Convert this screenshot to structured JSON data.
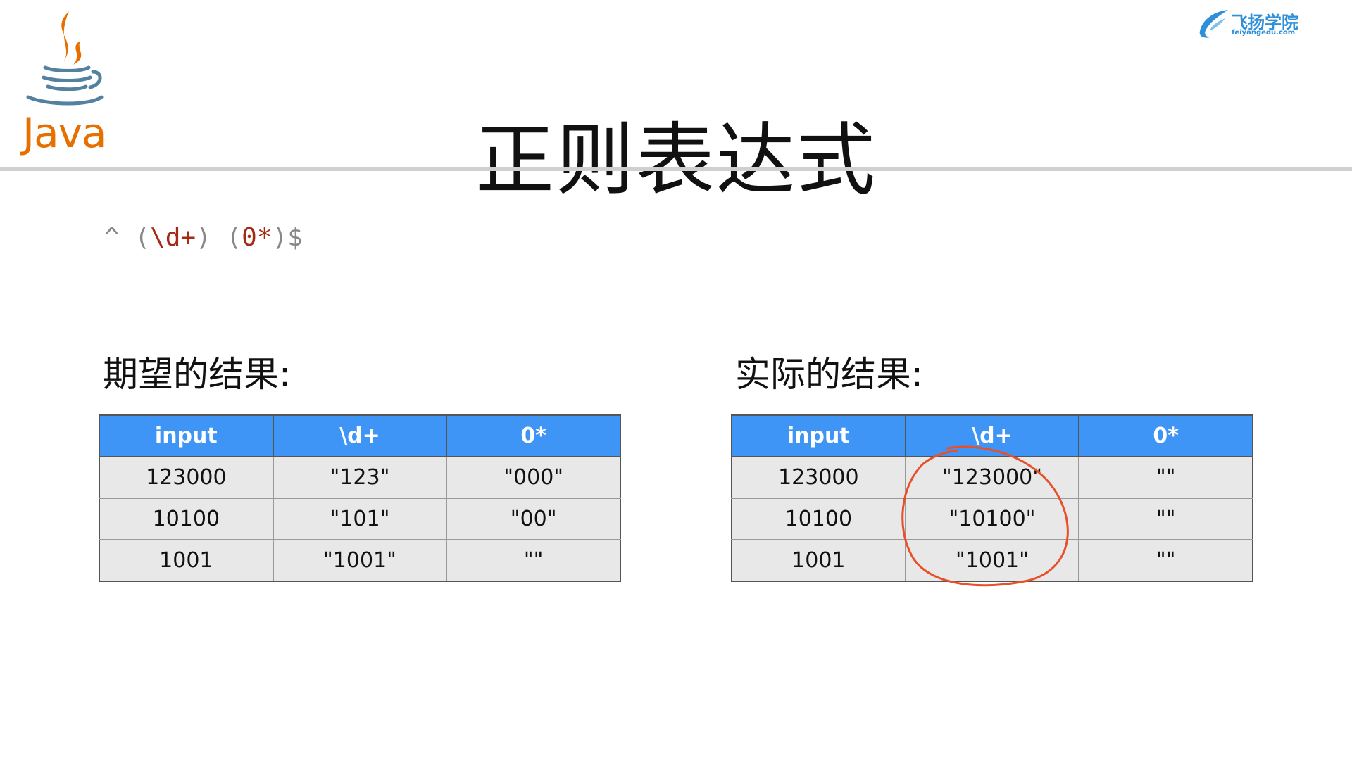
{
  "header": {
    "title": "正则表达式",
    "java_logo_text": "Java",
    "brand_name": "飞扬学院",
    "brand_domain": "feiyangedu.com"
  },
  "regex": {
    "anchor_start": "^",
    "open1": "(",
    "group1": "\\d+",
    "close1": ")",
    "open2": "(",
    "group2": "0*",
    "close2": ")",
    "anchor_end": "$"
  },
  "expected": {
    "heading": "期望的结果:",
    "columns": [
      "input",
      "\\d+",
      "0*"
    ],
    "rows": [
      [
        "123000",
        "\"123\"",
        "\"000\""
      ],
      [
        "10100",
        "\"101\"",
        "\"00\""
      ],
      [
        "1001",
        "\"1001\"",
        "\"\""
      ]
    ]
  },
  "actual": {
    "heading": "实际的结果:",
    "columns": [
      "input",
      "\\d+",
      "0*"
    ],
    "rows": [
      [
        "123000",
        "\"123000\"",
        "\"\""
      ],
      [
        "10100",
        "\"10100\"",
        "\"\""
      ],
      [
        "1001",
        "\"1001\"",
        "\"\""
      ]
    ]
  },
  "colors": {
    "table_header_bg": "#3f95f5",
    "table_cell_bg": "#e8e8e8",
    "regex_group": "#a32a14",
    "regex_meta": "#888888",
    "java_orange": "#e76f00",
    "java_blue": "#5382a1",
    "brand_blue": "#2f8fd8",
    "annotation_red": "#e8502a"
  },
  "icons": {
    "java_logo": "java-coffee-cup-icon",
    "brand_logo": "bird-wing-icon"
  }
}
